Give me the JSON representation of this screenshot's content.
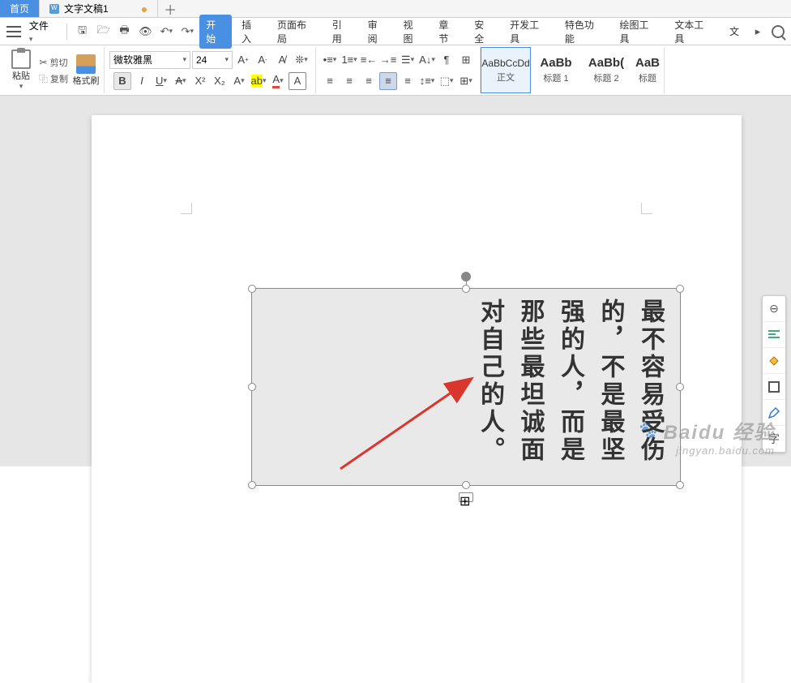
{
  "tabs": {
    "home": "首页",
    "doc1": "文字文稿1",
    "add": "＋"
  },
  "menu": {
    "file": "文件",
    "items": [
      "开始",
      "插入",
      "页面布局",
      "引用",
      "审阅",
      "视图",
      "章节",
      "安全",
      "开发工具",
      "特色功能",
      "绘图工具",
      "文本工具",
      "文"
    ]
  },
  "ribbon": {
    "paste": "粘贴",
    "cut": "剪切",
    "copy": "复制",
    "format_painter": "格式刷",
    "font_name": "微软雅黑",
    "font_size": "24",
    "styles": {
      "normal_preview": "AaBbCcDd",
      "normal_label": "正文",
      "h1_preview": "AaBb",
      "h1_label": "标题 1",
      "h2_preview": "AaBb(",
      "h2_label": "标题 2",
      "h3_preview": "AaB",
      "h3_label": "标题"
    }
  },
  "textbox": {
    "content": "最不容易受伤的，不是最坚强的人，而是那些最坦诚面对自己的人。"
  },
  "watermark": {
    "main": "Baidu 经验",
    "sub": "jingyan.baidu.com"
  }
}
